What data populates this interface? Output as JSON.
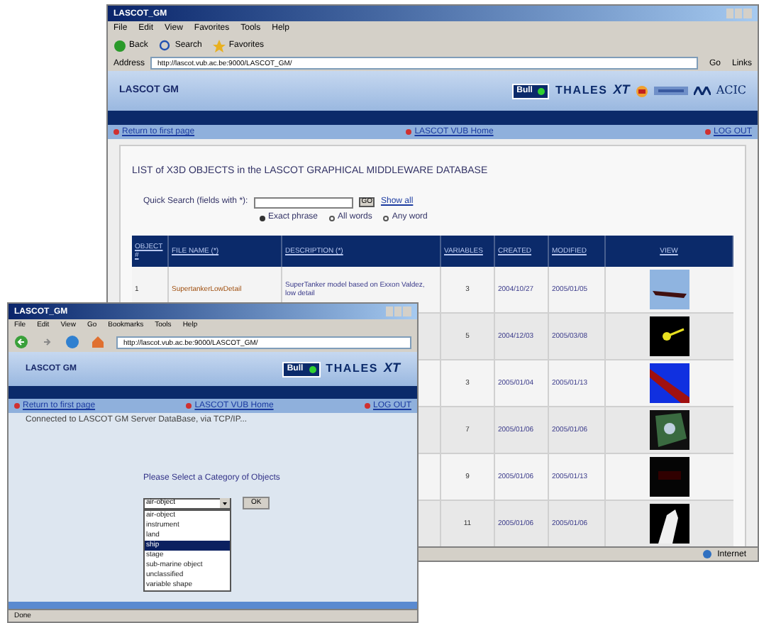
{
  "back_window": {
    "title": "LASCOT_GM",
    "menu": [
      "File",
      "Edit",
      "View",
      "Favorites",
      "Tools",
      "Help"
    ],
    "toolbar": [
      "Back",
      "Search",
      "Favorites"
    ],
    "address_label": "Address",
    "address": "http://lascot.vub.ac.be:9000/LASCOT_GM/",
    "go": "Go",
    "links_label": "Links",
    "site_title": "LASCOT GM",
    "logos": [
      "Bull",
      "THALES",
      "XT",
      "ACIC"
    ],
    "nav": [
      "Return to first page",
      "LASCOT VUB Home",
      "LOG OUT"
    ],
    "heading": "LIST of X3D OBJECTS in the LASCOT GRAPHICAL MIDDLEWARE DATABASE",
    "search": {
      "label": "Quick Search (fields with *):",
      "button": "GO",
      "show_all": "Show all"
    },
    "match": [
      {
        "label": "Exact phrase",
        "selected": true
      },
      {
        "label": "All words",
        "selected": false
      },
      {
        "label": "Any word",
        "selected": false
      }
    ],
    "table": {
      "columns": [
        "OBJECT #",
        "FILE NAME (*)",
        "DESCRIPTION (*)",
        "VARIABLES",
        "CREATED",
        "MODIFIED",
        "VIEW"
      ],
      "rows": [
        {
          "object": "1",
          "file": "SupertankerLowDetail",
          "description": "SuperTanker model based on Exxon Valdez, low detail",
          "variables": "3",
          "created": "2004/10/27",
          "modified": "2005/01/05"
        },
        {
          "variables": "5",
          "created": "2004/12/03",
          "modified": "2005/03/08"
        },
        {
          "variables": "3",
          "created": "2005/01/04",
          "modified": "2005/01/13"
        },
        {
          "variables": "7",
          "created": "2005/01/06",
          "modified": "2005/01/06"
        },
        {
          "variables": "9",
          "created": "2005/01/06",
          "modified": "2005/01/13"
        },
        {
          "variables": "11",
          "created": "2005/01/06",
          "modified": "2005/01/06"
        }
      ]
    },
    "status": "Internet"
  },
  "front_window": {
    "title": "LASCOT_GM",
    "menu": [
      "File",
      "Edit",
      "View",
      "Go",
      "Bookmarks",
      "Tools",
      "Help"
    ],
    "address": "http://lascot.vub.ac.be:9000/LASCOT_GM/",
    "site_title": "LASCOT GM",
    "logos": [
      "Bull",
      "THALES",
      "XT"
    ],
    "nav": [
      "Return to first page",
      "LASCOT VUB Home",
      "LOG OUT"
    ],
    "connected": "Connected to LASCOT GM Server DataBase, via TCP/IP...",
    "prompt": "Please Select a Category of Objects",
    "select_value": "air-object",
    "ok": "OK",
    "options": [
      {
        "label": "air-object",
        "selected": false
      },
      {
        "label": "instrument",
        "selected": false
      },
      {
        "label": "land",
        "selected": false
      },
      {
        "label": "ship",
        "selected": true
      },
      {
        "label": "stage",
        "selected": false
      },
      {
        "label": "sub-marine object",
        "selected": false
      },
      {
        "label": "unclassified",
        "selected": false
      },
      {
        "label": "variable shape",
        "selected": false
      }
    ],
    "status": "Done"
  }
}
